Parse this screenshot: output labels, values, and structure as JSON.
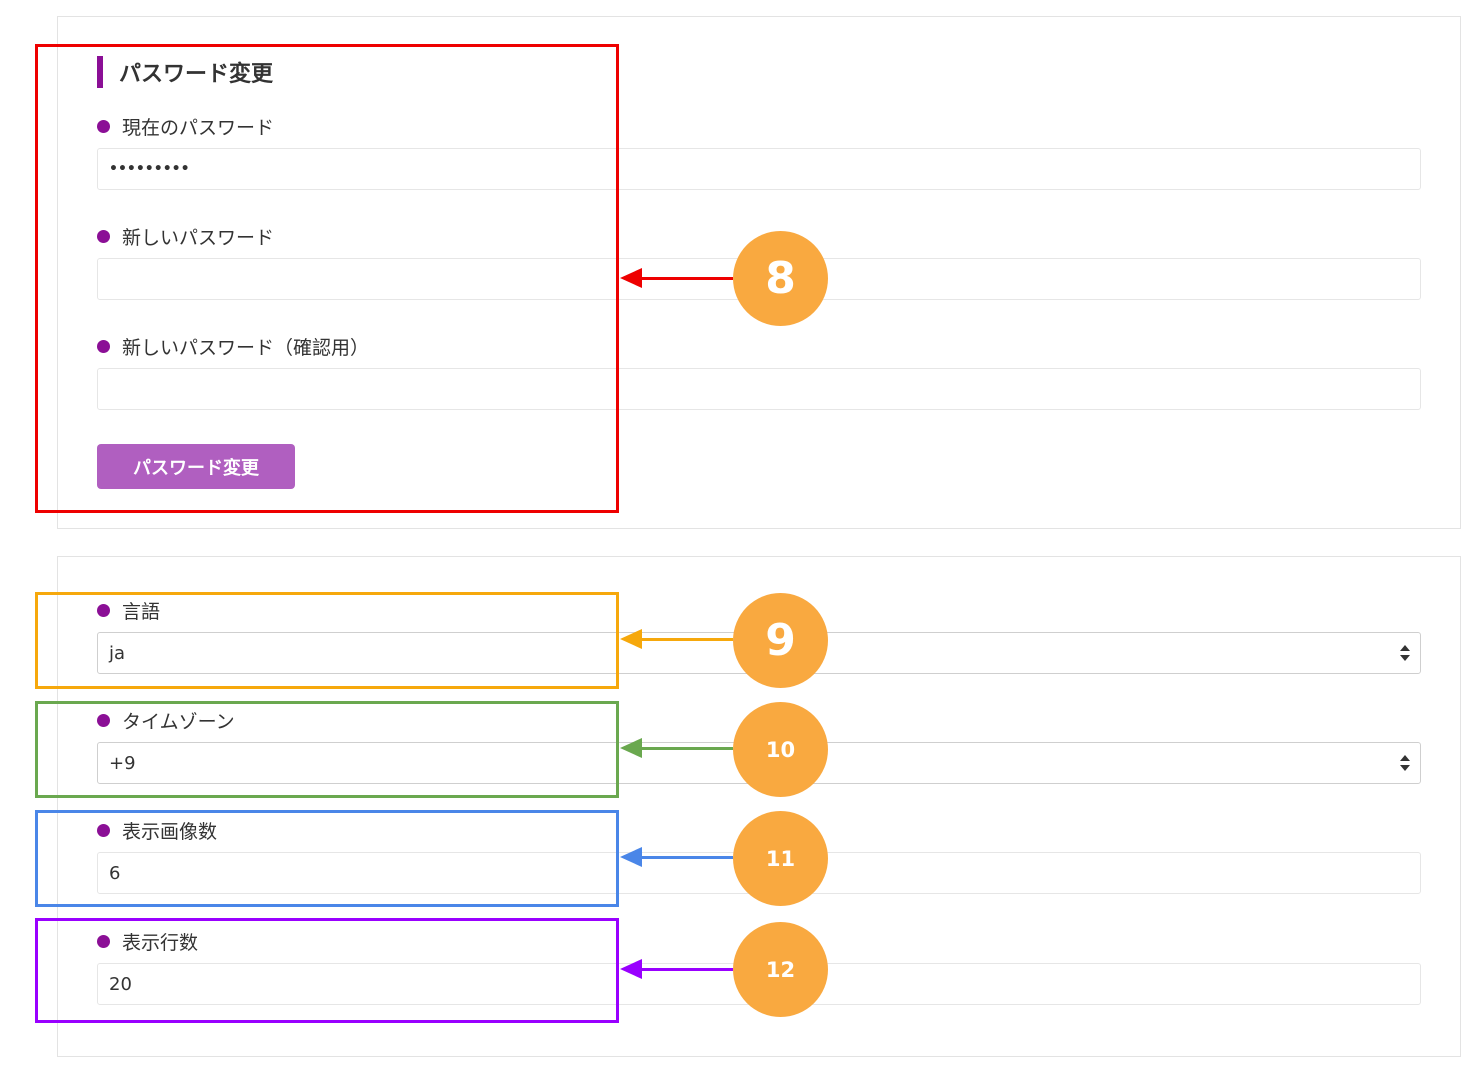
{
  "password_section": {
    "title": "パスワード変更",
    "current_password": {
      "label": "現在のパスワード",
      "value": "•••••••••"
    },
    "new_password": {
      "label": "新しいパスワード",
      "value": ""
    },
    "confirm_password": {
      "label": "新しいパスワード（確認用）",
      "value": ""
    },
    "submit_label": "パスワード変更"
  },
  "settings_section": {
    "language": {
      "label": "言語",
      "value": "ja"
    },
    "timezone": {
      "label": "タイムゾーン",
      "value": "+9"
    },
    "images_per_page": {
      "label": "表示画像数",
      "value": "6"
    },
    "rows_per_page": {
      "label": "表示行数",
      "value": "20"
    }
  },
  "annotations": [
    {
      "number": "8",
      "color": "#ee0000"
    },
    {
      "number": "9",
      "color": "#f6a80c"
    },
    {
      "number": "10",
      "color": "#6aa84f"
    },
    {
      "number": "11",
      "color": "#4a86e8"
    },
    {
      "number": "12",
      "color": "#9900ff"
    }
  ],
  "colors": {
    "accent": "#8b0f96",
    "button": "#b05fc0",
    "badge": "#f9a940"
  }
}
